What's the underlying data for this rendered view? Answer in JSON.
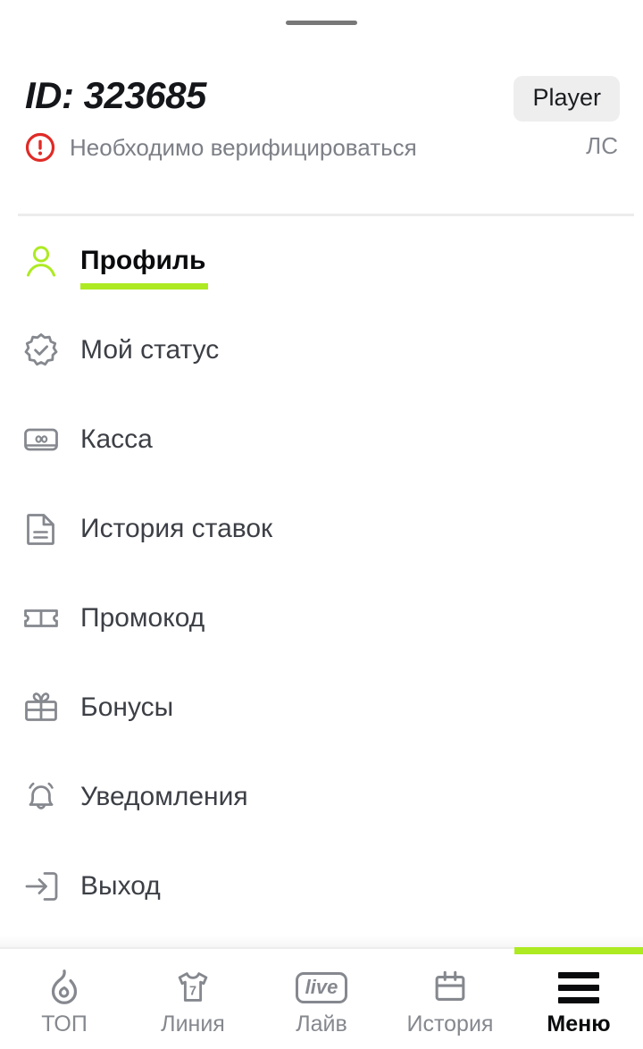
{
  "colors": {
    "accent_lime": "#adea22",
    "warning_red": "#e02b27",
    "icon_gray": "#85888e",
    "text_dark": "#3c3f45",
    "badge_bg": "#eeeeef"
  },
  "sheet": {
    "drag_handle_name": "drag-handle"
  },
  "header": {
    "id_label": "ID: 323685",
    "role_badge": "Player",
    "verification_notice": "Необходимо верифицироваться",
    "warning_icon": "exclamation-circle-icon",
    "personal_account_label": "ЛС"
  },
  "menu": {
    "items": [
      {
        "label": "Профиль",
        "icon": "user-icon",
        "active": true
      },
      {
        "label": "Мой статус",
        "icon": "badge-check-icon",
        "active": false
      },
      {
        "label": "Касса",
        "icon": "cash-register-icon",
        "active": false
      },
      {
        "label": "История ставок",
        "icon": "document-icon",
        "active": false
      },
      {
        "label": "Промокод",
        "icon": "ticket-icon",
        "active": false
      },
      {
        "label": "Бонусы",
        "icon": "gift-icon",
        "active": false
      },
      {
        "label": "Уведомления",
        "icon": "bell-icon",
        "active": false
      },
      {
        "label": "Выход",
        "icon": "logout-icon",
        "active": false
      }
    ]
  },
  "bottom_nav": {
    "items": [
      {
        "label": "ТОП",
        "icon": "flame-icon",
        "active": false
      },
      {
        "label": "Линия",
        "icon": "jersey-icon",
        "active": false,
        "jersey_number": "7"
      },
      {
        "label": "Лайв",
        "icon": "live-icon",
        "active": false,
        "live_text": "live"
      },
      {
        "label": "История",
        "icon": "calendar-icon",
        "active": false
      },
      {
        "label": "Меню",
        "icon": "hamburger-icon",
        "active": true
      }
    ]
  }
}
